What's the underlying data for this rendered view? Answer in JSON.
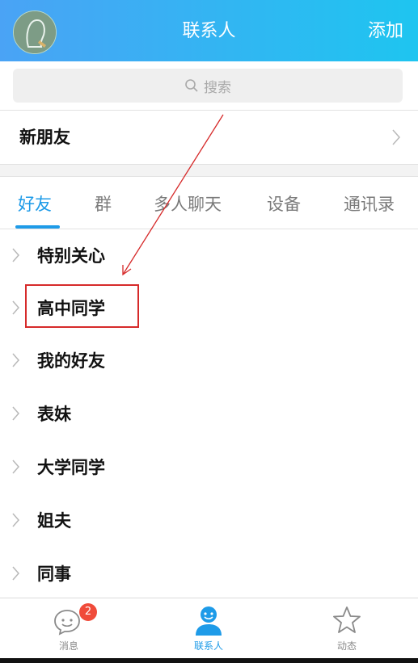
{
  "header": {
    "title": "联系人",
    "add_label": "添加"
  },
  "search": {
    "placeholder": "搜索"
  },
  "new_friends": {
    "label": "新朋友"
  },
  "tabs": [
    {
      "label": "好友",
      "active": true
    },
    {
      "label": "群",
      "active": false
    },
    {
      "label": "多人聊天",
      "active": false
    },
    {
      "label": "设备",
      "active": false
    },
    {
      "label": "通讯录",
      "active": false
    }
  ],
  "groups": [
    {
      "label": "特别关心"
    },
    {
      "label": "高中同学",
      "highlighted": true
    },
    {
      "label": "我的好友"
    },
    {
      "label": "表妹"
    },
    {
      "label": "大学同学"
    },
    {
      "label": "姐夫"
    },
    {
      "label": "同事"
    }
  ],
  "tabbar": {
    "items": [
      {
        "label": "消息",
        "icon": "chat-bubble-icon",
        "badge": "2",
        "active": false
      },
      {
        "label": "联系人",
        "icon": "person-icon",
        "active": true
      },
      {
        "label": "动态",
        "icon": "star-icon",
        "active": false
      }
    ]
  },
  "colors": {
    "accent": "#1e9be8",
    "header_start": "#4aa3f5",
    "header_end": "#1ec5f0",
    "annotation_red": "#d62a2a",
    "badge": "#f04b3a"
  }
}
